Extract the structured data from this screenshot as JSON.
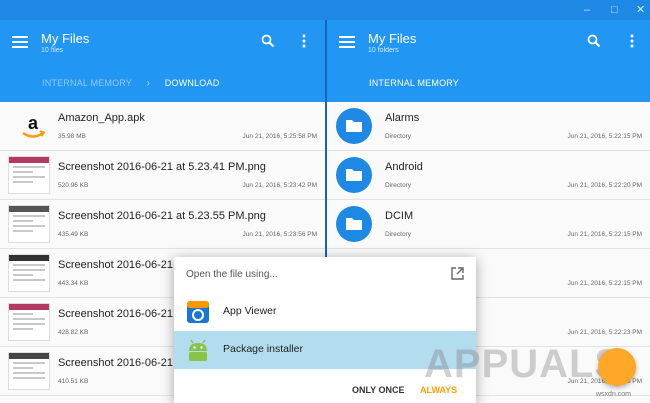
{
  "window": {
    "controls": [
      "–",
      "□",
      "✕"
    ]
  },
  "left_pane": {
    "title": "My Files",
    "subtitle": "10 files",
    "breadcrumbs": [
      "INTERNAL MEMORY",
      "DOWNLOAD"
    ],
    "files": [
      {
        "name": "Amazon_App.apk",
        "size": "35.98 MB",
        "date": "Jun 21, 2016, 5:25:58 PM",
        "kind": "apk"
      },
      {
        "name": "Screenshot 2016-06-21 at 5.23.41 PM.png",
        "size": "520.96 KB",
        "date": "Jun 21, 2016, 5:23:42 PM",
        "kind": "image"
      },
      {
        "name": "Screenshot 2016-06-21 at 5.23.55 PM.png",
        "size": "435.49 KB",
        "date": "Jun 21, 2016, 5:23:56 PM",
        "kind": "image"
      },
      {
        "name": "Screenshot 2016-06-21",
        "size": "443.34 KB",
        "date": "",
        "kind": "image"
      },
      {
        "name": "Screenshot 2016-06-21",
        "size": "428.82 KB",
        "date": "",
        "kind": "image"
      },
      {
        "name": "Screenshot 2016-06-21",
        "size": "410.51 KB",
        "date": "",
        "kind": "image"
      }
    ]
  },
  "right_pane": {
    "title": "My Files",
    "subtitle": "10 folders",
    "breadcrumbs": [
      "INTERNAL MEMORY"
    ],
    "folders": [
      {
        "name": "Alarms",
        "type": "Directory",
        "date": "Jun 21, 2016, 5:22:15 PM"
      },
      {
        "name": "Android",
        "type": "Directory",
        "date": "Jun 21, 2016, 5:22:20 PM"
      },
      {
        "name": "DCIM",
        "type": "Directory",
        "date": "Jun 21, 2016, 5:22:15 PM"
      },
      {
        "name": "",
        "type": "",
        "date": "Jun 21, 2016, 5:22:15 PM"
      },
      {
        "name": "",
        "type": "",
        "date": "Jun 21, 2016, 5:22:23 PM"
      },
      {
        "name": "",
        "type": "",
        "date": "Jun 21, 2016, 5:22:15 PM"
      }
    ]
  },
  "dialog": {
    "title": "Open the file using...",
    "options": [
      {
        "label": "App Viewer",
        "selected": false
      },
      {
        "label": "Package installer",
        "selected": true
      }
    ],
    "buttons": {
      "once": "ONLY ONCE",
      "always": "ALWAYS"
    }
  },
  "watermark": {
    "brand": "APPUALS",
    "site": "wsxdn.com"
  },
  "colors": {
    "appbar": "#2196f3",
    "accent": "#ffa000",
    "selected": "#b3dcee",
    "folder": "#1e88e5"
  }
}
